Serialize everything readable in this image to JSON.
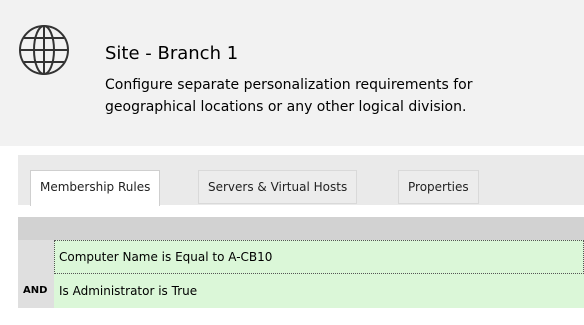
{
  "header": {
    "icon": "globe-icon",
    "title": "Site - Branch 1",
    "description_line1": "Configure separate personalization requirements for",
    "description_line2": "geographical locations or any other logical division."
  },
  "tabs": [
    {
      "label": "Membership Rules",
      "active": true
    },
    {
      "label": "Servers & Virtual Hosts",
      "active": false
    },
    {
      "label": "Properties",
      "active": false
    }
  ],
  "rules": [
    {
      "operator": "",
      "condition": "Computer Name is Equal to A-CB10",
      "focused": true
    },
    {
      "operator": "AND",
      "condition": "Is Administrator is True",
      "focused": false
    }
  ],
  "colors": {
    "header_bg": "#f2f2f2",
    "rule_bg": "#dbf7d8",
    "grid_header_bg": "#d2d2d2"
  }
}
